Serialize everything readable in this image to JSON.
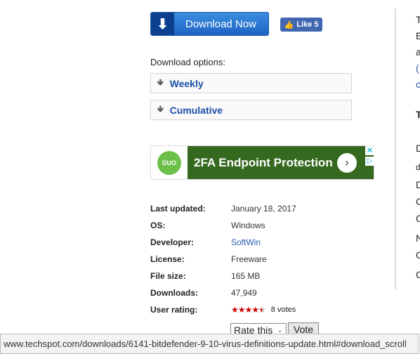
{
  "download_button": {
    "label": "Download Now",
    "icon": "arrow-down-icon"
  },
  "like_button": {
    "label": "Like 5",
    "icon": "thumbs-up-icon"
  },
  "download_options": {
    "label": "Download options:",
    "items": [
      {
        "label": "Weekly"
      },
      {
        "label": "Cumulative"
      }
    ]
  },
  "ad": {
    "logo": "DUO",
    "headline": "2FA Endpoint Protection"
  },
  "details": [
    {
      "key": "Last updated:",
      "value": "January 18, 2017"
    },
    {
      "key": "OS:",
      "value": "Windows"
    },
    {
      "key": "Developer:",
      "value": "SoftWin"
    },
    {
      "key": "License:",
      "value": "Freeware"
    },
    {
      "key": "File size:",
      "value": "165 MB"
    },
    {
      "key": "Downloads:",
      "value": "47,949"
    }
  ],
  "rating": {
    "label": "User rating:",
    "stars": 4.5,
    "max": 5,
    "votes": "8 votes",
    "star_color": "#cc0000"
  },
  "rate_select": {
    "value": "Rate this"
  },
  "vote_button": {
    "label": "Vote"
  },
  "right_column_fragments": [
    "T",
    "E",
    "a",
    "(",
    "c",
    "T",
    "D",
    "d",
    "D",
    "C",
    "C",
    "N",
    "C",
    "C"
  ],
  "status_bar": {
    "url": "www.techspot.com/downloads/6141-bitdefender-9-10-virus-definitions-update.html#download_scroll"
  }
}
